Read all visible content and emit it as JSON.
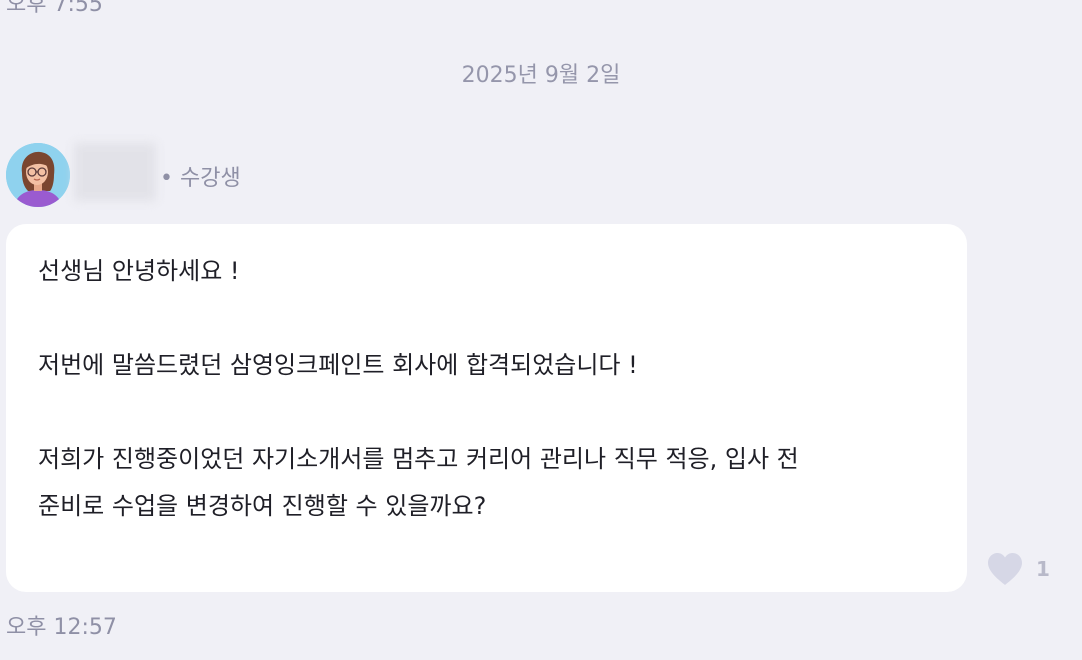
{
  "previous_message": {
    "time": "오후 7:55"
  },
  "date_divider": "2025년 9월 2일",
  "message": {
    "sender": {
      "name": "",
      "role_text": "• 수강생",
      "avatar_icon": "user-avatar-woman-glasses"
    },
    "lines": [
      "선생님 안녕하세요 !",
      "",
      "저번에 말씀드렸던 삼영잉크페인트 회사에 합격되었습니다 !",
      "",
      "저희가 진행중이었던 자기소개서를 멈추고 커리어 관리나 직무 적응, 입사 전",
      "준비로 수업을 변경하여 진행할 수 있을까요?"
    ],
    "time": "오후 12:57",
    "reaction": {
      "icon": "heart-icon",
      "count": "1",
      "color": "#d6d7e6"
    }
  },
  "colors": {
    "background": "#f0f0f6",
    "bubble": "#ffffff",
    "muted_text": "#8f90a6",
    "body_text": "#1f1f27"
  }
}
